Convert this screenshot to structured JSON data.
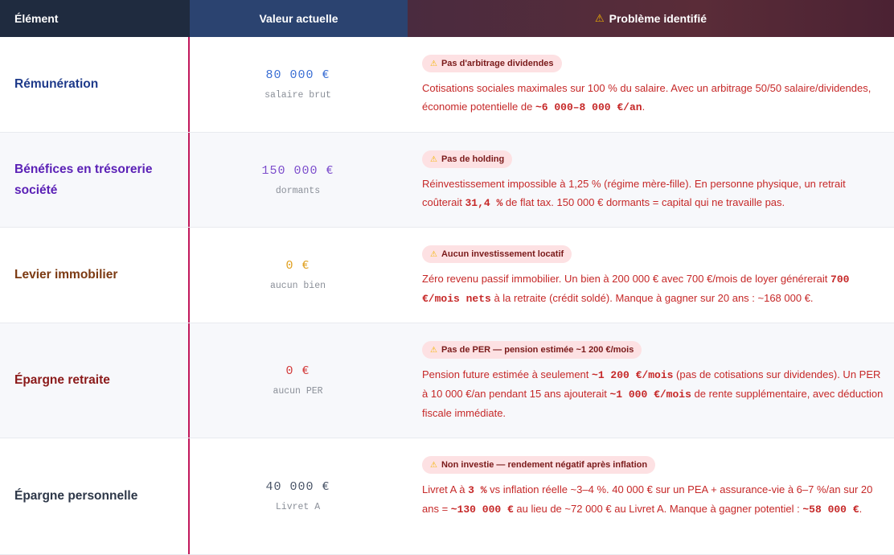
{
  "header": {
    "col1": "Élément",
    "col2": "Valeur actuelle",
    "col3": "Problème identifié",
    "col3_icon": "warning-icon"
  },
  "rows": [
    {
      "label": "Rémunération",
      "label_color": "#1e3a8a",
      "value": "80 000 €",
      "value_color": "#3b6fd4",
      "sub": "salaire brut",
      "badge": "Pas d'arbitrage dividendes",
      "desc": [
        {
          "t": "Cotisations sociales maximales sur 100 % du salaire. Avec un arbitrage 50/50 salaire/dividendes, économie potentielle de ",
          "m": false
        },
        {
          "t": "~6 000–8 000 €/an",
          "m": true
        },
        {
          "t": ".",
          "m": false
        }
      ]
    },
    {
      "label": "Bénéfices en trésorerie société",
      "label_color": "#5b21b6",
      "value": "150 000 €",
      "value_color": "#7c4dcc",
      "sub": "dormants",
      "badge": "Pas de holding",
      "desc": [
        {
          "t": "Réinvestissement impossible à 1,25 % (régime mère-fille). En personne physique, un retrait coûterait ",
          "m": false
        },
        {
          "t": "31,4 %",
          "m": true
        },
        {
          "t": " de flat tax. 150 000 € dormants = capital qui ne travaille pas.",
          "m": false
        }
      ]
    },
    {
      "label": "Levier immobilier",
      "label_color": "#7c3a12",
      "value": "0 €",
      "value_color": "#e0a020",
      "sub": "aucun bien",
      "badge": "Aucun investissement locatif",
      "desc": [
        {
          "t": "Zéro revenu passif immobilier. Un bien à 200 000 € avec 700 €/mois de loyer générerait ",
          "m": false
        },
        {
          "t": "700 €/mois nets",
          "m": true
        },
        {
          "t": " à la retraite (crédit soldé). Manque à gagner sur 20 ans : ~168 000 €.",
          "m": false
        }
      ]
    },
    {
      "label": "Épargne retraite",
      "label_color": "#8b1a1a",
      "value": "0 €",
      "value_color": "#d33b3b",
      "sub": "aucun PER",
      "badge": "Pas de PER — pension estimée ~1 200 €/mois",
      "desc": [
        {
          "t": "Pension future estimée à seulement ",
          "m": false
        },
        {
          "t": "~1 200 €/mois",
          "m": true
        },
        {
          "t": " (pas de cotisations sur dividendes). Un PER à 10 000 €/an pendant 15 ans ajouterait ",
          "m": false
        },
        {
          "t": "~1 000 €/mois",
          "m": true
        },
        {
          "t": " de rente supplémentaire, avec déduction fiscale immédiate.",
          "m": false
        }
      ]
    },
    {
      "label": "Épargne personnelle",
      "label_color": "#2d3748",
      "value": "40 000 €",
      "value_color": "#4a5568",
      "sub": "Livret A",
      "badge": "Non investie — rendement négatif après inflation",
      "desc": [
        {
          "t": "Livret A à ",
          "m": false
        },
        {
          "t": "3 %",
          "m": true
        },
        {
          "t": " vs inflation réelle ~3–4 %. 40 000 € sur un PEA + assurance-vie à 6–7 %/an sur 20 ans = ",
          "m": false
        },
        {
          "t": "~130 000 €",
          "m": true
        },
        {
          "t": " au lieu de ~72 000 € au Livret A. Manque à gagner potentiel : ",
          "m": false
        },
        {
          "t": "~58 000 €",
          "m": true
        },
        {
          "t": ".",
          "m": false
        }
      ]
    }
  ]
}
